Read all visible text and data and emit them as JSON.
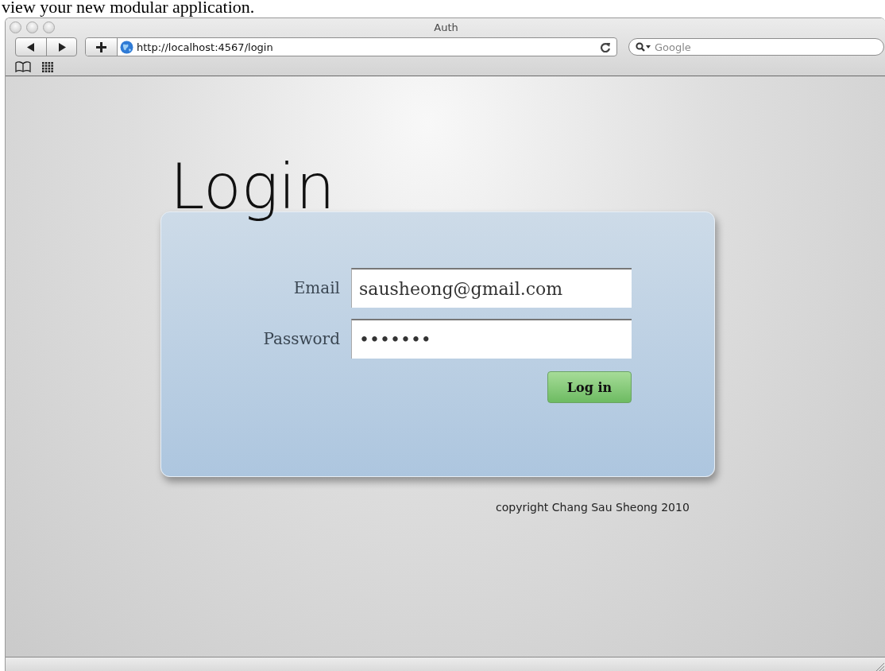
{
  "page_caption": "view your new modular application.",
  "window": {
    "title": "Auth"
  },
  "toolbar": {
    "address": "http://localhost:4567/login",
    "search": {
      "placeholder": "Google"
    }
  },
  "login": {
    "heading": "Login",
    "fields": [
      {
        "label": "Email",
        "value": "sausheong@gmail.com"
      },
      {
        "label": "Password",
        "value": "•••••••"
      }
    ],
    "button": "Log in",
    "footer": "copyright Chang Sau Sheong 2010"
  }
}
